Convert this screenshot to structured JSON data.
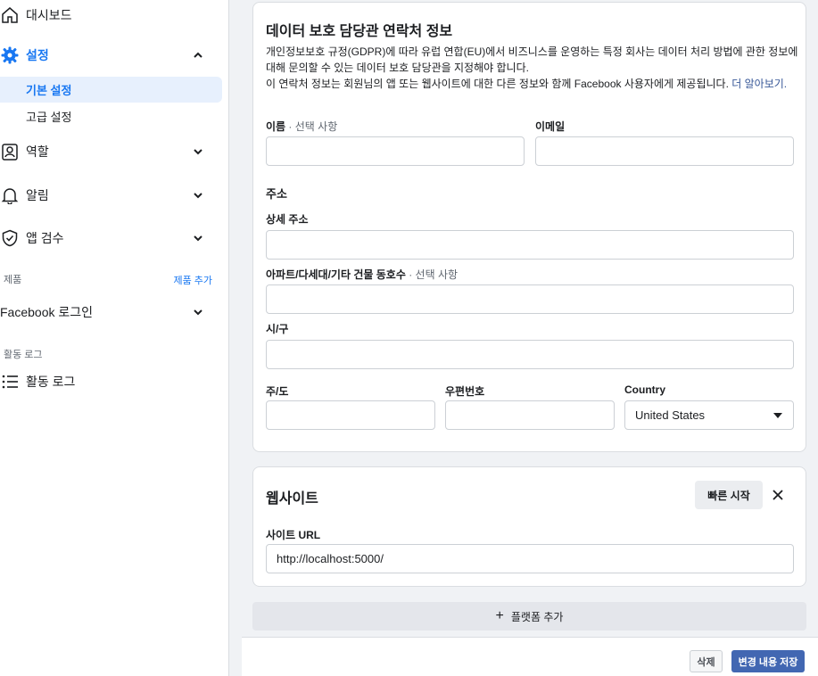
{
  "sidebar": {
    "dashboard": {
      "label": "대시보드",
      "icon": "home-icon"
    },
    "settings": {
      "label": "설정",
      "icon": "gear-icon"
    },
    "settings_sub": [
      "기본 설정",
      "고급 설정"
    ],
    "roles": {
      "label": "역할",
      "icon": "person-badge-icon"
    },
    "alerts": {
      "label": "알림",
      "icon": "bell-icon"
    },
    "app_review": {
      "label": "앱 검수",
      "icon": "shield-check-icon"
    },
    "products_section": {
      "label": "제품",
      "link": "제품 추가"
    },
    "facebook_login": {
      "label": "Facebook 로그인"
    },
    "activity_section": {
      "label": "활동 로그"
    },
    "activity_log": {
      "label": "활동 로그",
      "icon": "list-icon"
    }
  },
  "dpo_card": {
    "title": "데이터 보호 담당관 연락처 정보",
    "desc_line1": "개인정보보호 규정(GDPR)에 따라 유럽 연합(EU)에서 비즈니스를 운영하는 특정 회사는 데이터 처리 방법에 관한 정보에",
    "desc_line2": "대해 문의할 수 있는 데이터 보호 담당관을 지정해야 합니다.",
    "desc_line3": "이 연락처 정보는 회원님의 앱 또는 웹사이트에 대한 다른 정보와 함께 Facebook 사용자에게 제공됩니다. ",
    "desc_link": "더 알아보기.",
    "name_label": "이름",
    "name_optional": " · 선택 사항",
    "email_label": "이메일",
    "address_heading": "주소",
    "street_label": "상세 주소",
    "apt_label": "아파트/다세대/기타 건물 동호수",
    "apt_optional": " · 선택 사항",
    "city_label": "시/구",
    "state_label": "주/도",
    "zip_label": "우편번호",
    "country_label": "Country",
    "country_value": "United States"
  },
  "website_card": {
    "title": "웹사이트",
    "quickstart_label": "빠른 시작",
    "site_url_label": "사이트 URL",
    "site_url_value": "http://localhost:5000/"
  },
  "add_platform_label": "플랫폼 추가",
  "footer": {
    "delete_label": "삭제",
    "save_label": "변경 내용 저장"
  },
  "colors": {
    "accent": "#1877f2",
    "save": "#4267b2"
  }
}
